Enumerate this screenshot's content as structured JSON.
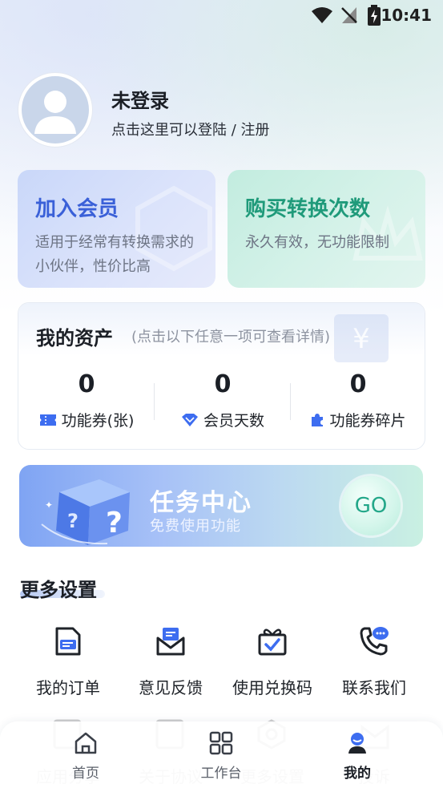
{
  "status_bar": {
    "time": "10:41"
  },
  "profile": {
    "name": "未登录",
    "subtitle": "点击这里可以登陆 / 注册"
  },
  "vip_card": {
    "title": "加入会员",
    "desc": "适用于经常有转换需求的小伙伴，性价比高"
  },
  "buy_card": {
    "title": "购买转换次数",
    "desc": "永久有效，无功能限制"
  },
  "assets": {
    "title": "我的资产",
    "hint": "(点击以下任意一项可查看详情)",
    "items": [
      {
        "value": "0",
        "label": "功能券(张)",
        "icon": "ticket-icon"
      },
      {
        "value": "0",
        "label": "会员天数",
        "icon": "diamond-icon"
      },
      {
        "value": "0",
        "label": "功能券碎片",
        "icon": "puzzle-icon"
      }
    ]
  },
  "task_banner": {
    "title": "任务中心",
    "subtitle": "免费使用功能",
    "go_label": "GO"
  },
  "more_settings": {
    "title": "更多设置",
    "items": [
      {
        "label": "我的订单",
        "icon": "order-icon"
      },
      {
        "label": "意见反馈",
        "icon": "feedback-icon"
      },
      {
        "label": "使用兑换码",
        "icon": "redeem-code-icon"
      },
      {
        "label": "联系我们",
        "icon": "contact-icon"
      }
    ],
    "row2_partial": [
      "应用分享",
      "关于协议",
      "更多设置",
      "投诉"
    ]
  },
  "bottom_nav": {
    "items": [
      {
        "label": "首页",
        "icon": "home-icon",
        "active": false
      },
      {
        "label": "工作台",
        "icon": "workbench-icon",
        "active": false
      },
      {
        "label": "我的",
        "icon": "profile-icon",
        "active": true
      }
    ]
  },
  "colors": {
    "vip_title": "#3a60d8",
    "buy_title": "#1f9a7a",
    "accent_blue": "#3d6df0",
    "go_text": "#23a789"
  }
}
